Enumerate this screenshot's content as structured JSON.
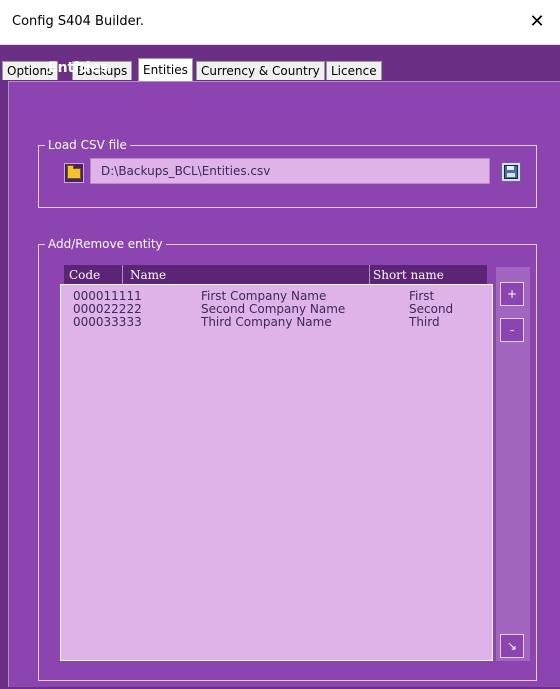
{
  "window": {
    "title": "Config S404 Builder.",
    "close_glyph": "✕"
  },
  "tabs": [
    {
      "label": "Options"
    },
    {
      "label": "Backups"
    },
    {
      "label": "Entities"
    },
    {
      "label": "Currency & Country"
    },
    {
      "label": "Licence"
    }
  ],
  "active_tab": "Entities",
  "page": {
    "heading": "Entities",
    "load_group": {
      "legend": "Load CSV file",
      "path_value": "D:\\Backups_BCL\\Entities.csv"
    },
    "entity_group": {
      "legend": "Add/Remove entity",
      "columns": [
        "Code",
        "Name",
        "Short name"
      ],
      "rows": [
        {
          "code": "000011111",
          "name": "First Company Name",
          "short": "First"
        },
        {
          "code": "000022222",
          "name": "Second Company Name",
          "short": "Second"
        },
        {
          "code": "000033333",
          "name": "Third Company Name",
          "short": "Third"
        }
      ],
      "add_label": "+",
      "remove_label": "-",
      "bottom_label": "↘"
    }
  },
  "colors": {
    "frame": "#6b2f86",
    "panel": "#8b44b0",
    "field": "#dfb3e8"
  }
}
